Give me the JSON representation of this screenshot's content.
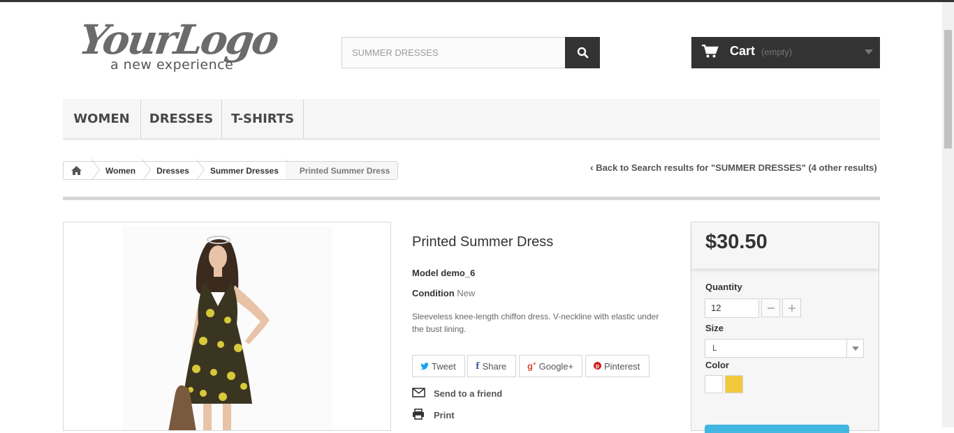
{
  "logo": {
    "line1": "YourLogo",
    "line2": "a new experience"
  },
  "search": {
    "placeholder": "SUMMER DRESSES",
    "icon": "search-icon"
  },
  "cart": {
    "label": "Cart",
    "status": "(empty)"
  },
  "nav": {
    "items": [
      "WOMEN",
      "DRESSES",
      "T-SHIRTS"
    ]
  },
  "breadcrumb": {
    "items": [
      "Women",
      "Dresses",
      "Summer Dresses"
    ],
    "current": "Printed Summer Dress"
  },
  "back_link": "Back to Search results for \"SUMMER DRESSES\" (4 other results)",
  "product": {
    "title": "Printed Summer Dress",
    "model_label": "Model",
    "model_value": "demo_6",
    "condition_label": "Condition",
    "condition_value": "New",
    "description": "Sleeveless knee-length chiffon dress. V-neckline with elastic under the bust lining."
  },
  "social": {
    "tweet": "Tweet",
    "share": "Share",
    "googleplus": "Google+",
    "pinterest": "Pinterest"
  },
  "actions": {
    "send": "Send to a friend",
    "print": "Print"
  },
  "buy": {
    "price": "$30.50",
    "quantity_label": "Quantity",
    "quantity_value": "12",
    "size_label": "Size",
    "size_value": "L",
    "color_label": "Color",
    "colors": [
      "#ffffff",
      "#f1c93b"
    ]
  },
  "colors": {
    "dark": "#333333",
    "accent": "#43b7df"
  }
}
